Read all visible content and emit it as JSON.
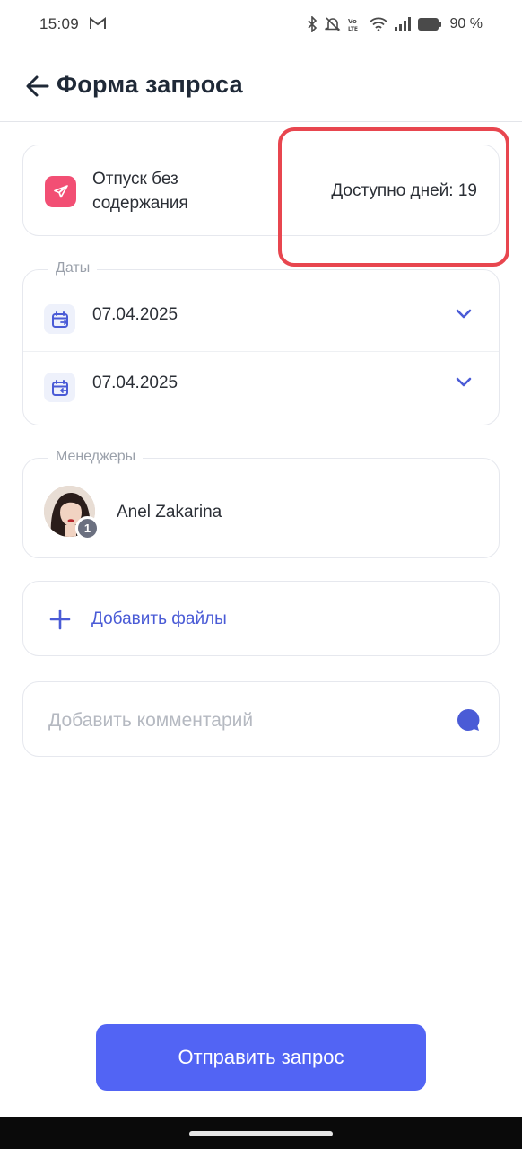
{
  "status_bar": {
    "time": "15:09",
    "battery": "90 %",
    "icons": [
      "gmail-icon",
      "bluetooth-icon",
      "mute-icon",
      "volte-icon",
      "wifi-icon",
      "signal-icon",
      "battery-icon"
    ]
  },
  "header": {
    "title": "Форма запроса",
    "back_icon": "arrow-left-icon"
  },
  "request_type": {
    "label": "Отпуск без содержания",
    "available": "Доступно дней: 19",
    "icon": "airplane-icon",
    "icon_color": "#f24f74"
  },
  "dates": {
    "group_label": "Даты",
    "start_date": "07.04.2025",
    "end_date": "07.04.2025"
  },
  "managers": {
    "group_label": "Менеджеры",
    "name": "Anel Zakarina",
    "badge": "1"
  },
  "files": {
    "label": "Добавить файлы"
  },
  "comment": {
    "placeholder": "Добавить комментарий",
    "value": ""
  },
  "submit": {
    "label": "Отправить запрос"
  },
  "colors": {
    "accent": "#5264f4",
    "link": "#4a5bd6",
    "highlight": "#e8464f"
  }
}
